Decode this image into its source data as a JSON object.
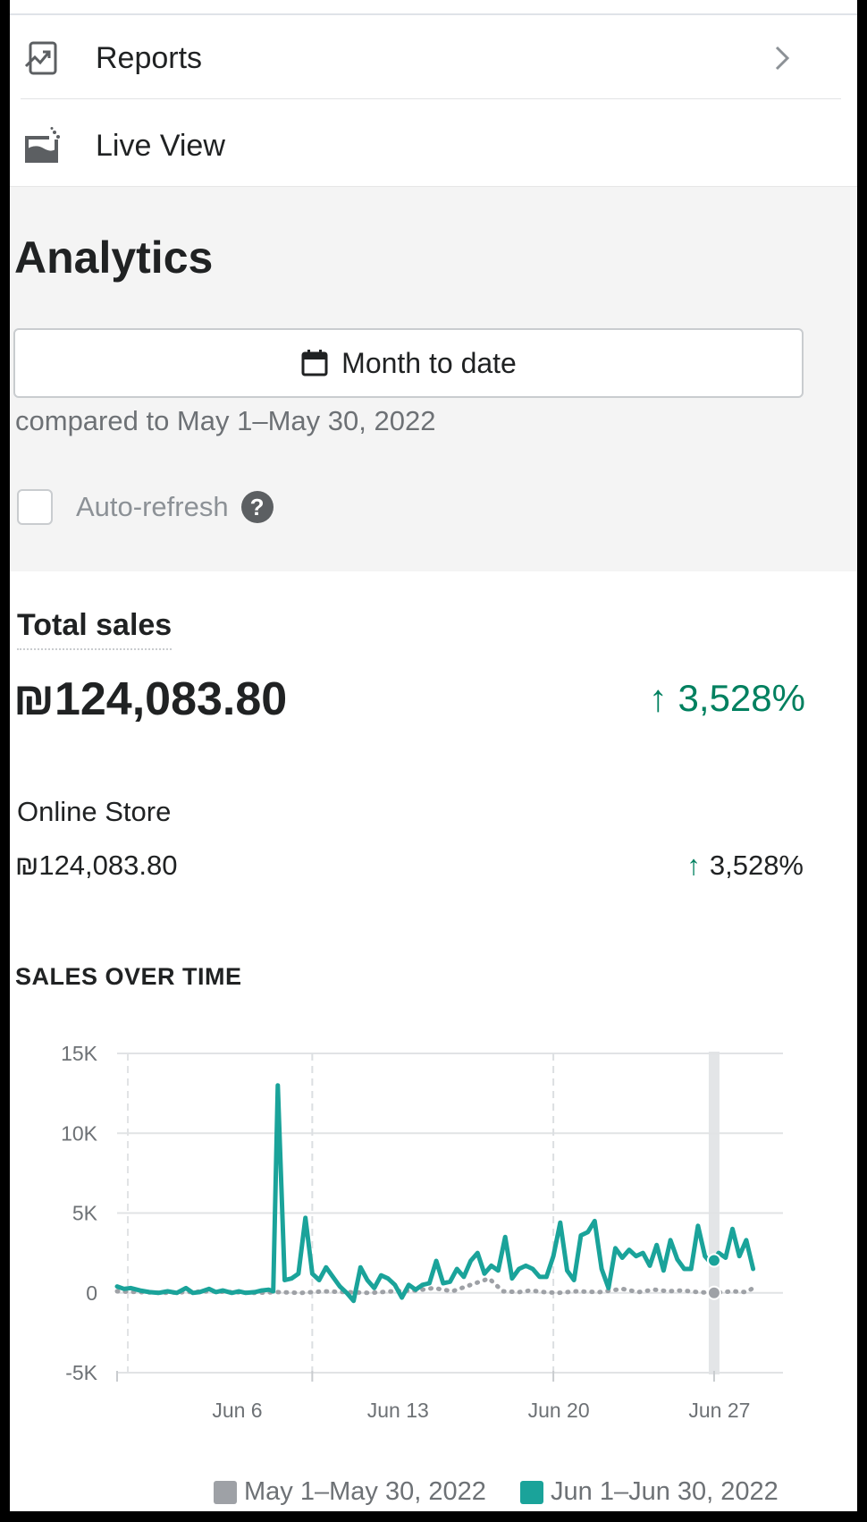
{
  "nav": {
    "reports_label": "Reports",
    "live_view_label": "Live View"
  },
  "analytics": {
    "title": "Analytics",
    "date_range_label": "Month to date",
    "compared_text": "compared to May 1–May 30, 2022",
    "auto_refresh_label": "Auto-refresh",
    "help_glyph": "?"
  },
  "total_sales": {
    "label": "Total sales",
    "value": "₪124,083.80",
    "change": "3,528%",
    "change_arrow": "↑",
    "change_color": "#00805f"
  },
  "online_store": {
    "label": "Online Store",
    "value": "₪124,083.80",
    "change": "3,528%",
    "change_arrow": "↑"
  },
  "sales_over_time": {
    "title": "SALES OVER TIME"
  },
  "chart_data": {
    "type": "line",
    "title": "SALES OVER TIME",
    "xlabel": "",
    "ylabel": "",
    "ylim": [
      -5000,
      15000
    ],
    "yticks": [
      "15K",
      "10K",
      "5K",
      "0",
      "-5K"
    ],
    "ytick_values": [
      15000,
      10000,
      5000,
      0,
      -5000
    ],
    "xticks": [
      "Jun 6",
      "Jun 13",
      "Jun 20",
      "Jun 27"
    ],
    "xtick_days": [
      6,
      13,
      20,
      27
    ],
    "x_range_days": [
      1,
      30
    ],
    "grid": true,
    "highlight_day": 27,
    "legend_position": "bottom",
    "series": [
      {
        "name": "Jun 1–Jun 30, 2022",
        "color": "#1aa39a",
        "style": "solid",
        "points": [
          [
            1.0,
            400
          ],
          [
            1.3,
            250
          ],
          [
            1.6,
            300
          ],
          [
            2.0,
            150
          ],
          [
            2.4,
            50
          ],
          [
            2.8,
            0
          ],
          [
            3.2,
            100
          ],
          [
            3.6,
            0
          ],
          [
            4.0,
            300
          ],
          [
            4.3,
            0
          ],
          [
            4.6,
            50
          ],
          [
            5.0,
            250
          ],
          [
            5.3,
            50
          ],
          [
            5.6,
            150
          ],
          [
            6.0,
            0
          ],
          [
            6.3,
            100
          ],
          [
            6.6,
            0
          ],
          [
            7.0,
            50
          ],
          [
            7.3,
            150
          ],
          [
            7.6,
            200
          ],
          [
            7.8,
            100
          ],
          [
            8.0,
            13000
          ],
          [
            8.3,
            800
          ],
          [
            8.6,
            900
          ],
          [
            8.9,
            1200
          ],
          [
            9.2,
            4700
          ],
          [
            9.5,
            1200
          ],
          [
            9.8,
            800
          ],
          [
            10.1,
            1600
          ],
          [
            10.4,
            1000
          ],
          [
            10.7,
            400
          ],
          [
            11.0,
            0
          ],
          [
            11.3,
            -500
          ],
          [
            11.6,
            1600
          ],
          [
            11.9,
            800
          ],
          [
            12.2,
            300
          ],
          [
            12.5,
            1100
          ],
          [
            12.8,
            900
          ],
          [
            13.1,
            500
          ],
          [
            13.4,
            -300
          ],
          [
            13.7,
            500
          ],
          [
            14.0,
            200
          ],
          [
            14.3,
            500
          ],
          [
            14.6,
            600
          ],
          [
            14.9,
            2000
          ],
          [
            15.2,
            600
          ],
          [
            15.5,
            700
          ],
          [
            15.8,
            1500
          ],
          [
            16.1,
            1000
          ],
          [
            16.4,
            2000
          ],
          [
            16.7,
            2500
          ],
          [
            17.0,
            1200
          ],
          [
            17.3,
            1700
          ],
          [
            17.6,
            1400
          ],
          [
            17.9,
            3500
          ],
          [
            18.2,
            900
          ],
          [
            18.5,
            1500
          ],
          [
            18.8,
            1700
          ],
          [
            19.1,
            1500
          ],
          [
            19.4,
            1000
          ],
          [
            19.7,
            1000
          ],
          [
            20.0,
            2300
          ],
          [
            20.3,
            4400
          ],
          [
            20.6,
            1400
          ],
          [
            20.9,
            800
          ],
          [
            21.2,
            3600
          ],
          [
            21.5,
            3800
          ],
          [
            21.8,
            4500
          ],
          [
            22.1,
            1500
          ],
          [
            22.4,
            300
          ],
          [
            22.7,
            2800
          ],
          [
            23.0,
            2200
          ],
          [
            23.3,
            2700
          ],
          [
            23.6,
            2300
          ],
          [
            23.9,
            2500
          ],
          [
            24.2,
            1700
          ],
          [
            24.5,
            3000
          ],
          [
            24.8,
            1400
          ],
          [
            25.1,
            3300
          ],
          [
            25.4,
            2100
          ],
          [
            25.7,
            1500
          ],
          [
            26.0,
            1500
          ],
          [
            26.3,
            4200
          ],
          [
            26.6,
            2300
          ],
          [
            26.9,
            1800
          ],
          [
            27.2,
            2500
          ],
          [
            27.5,
            2200
          ],
          [
            27.8,
            4000
          ],
          [
            28.1,
            2300
          ],
          [
            28.4,
            3300
          ],
          [
            28.7,
            1500
          ]
        ]
      },
      {
        "name": "May 1–May 30, 2022",
        "color": "#9ea1a6",
        "style": "dotted",
        "points": [
          [
            1.0,
            100
          ],
          [
            2.0,
            50
          ],
          [
            3.0,
            0
          ],
          [
            4.0,
            50
          ],
          [
            5.0,
            100
          ],
          [
            6.0,
            50
          ],
          [
            7.0,
            0
          ],
          [
            8.0,
            50
          ],
          [
            9.0,
            0
          ],
          [
            10.0,
            100
          ],
          [
            11.0,
            50
          ],
          [
            12.0,
            0
          ],
          [
            13.0,
            100
          ],
          [
            14.0,
            150
          ],
          [
            14.8,
            300
          ],
          [
            15.6,
            100
          ],
          [
            16.4,
            500
          ],
          [
            17.2,
            900
          ],
          [
            17.8,
            100
          ],
          [
            18.5,
            50
          ],
          [
            19.0,
            150
          ],
          [
            19.6,
            50
          ],
          [
            20.2,
            0
          ],
          [
            21.0,
            100
          ],
          [
            22.0,
            50
          ],
          [
            23.0,
            250
          ],
          [
            23.7,
            50
          ],
          [
            24.4,
            200
          ],
          [
            25.0,
            100
          ],
          [
            25.6,
            150
          ],
          [
            26.3,
            50
          ],
          [
            27.0,
            0
          ],
          [
            27.8,
            100
          ],
          [
            28.4,
            50
          ],
          [
            28.7,
            300
          ]
        ]
      }
    ]
  },
  "legend": {
    "prev_label": "May 1–May 30, 2022",
    "prev_color": "#9ea1a6",
    "curr_label": "Jun 1–Jun 30, 2022",
    "curr_color": "#1aa39a"
  }
}
